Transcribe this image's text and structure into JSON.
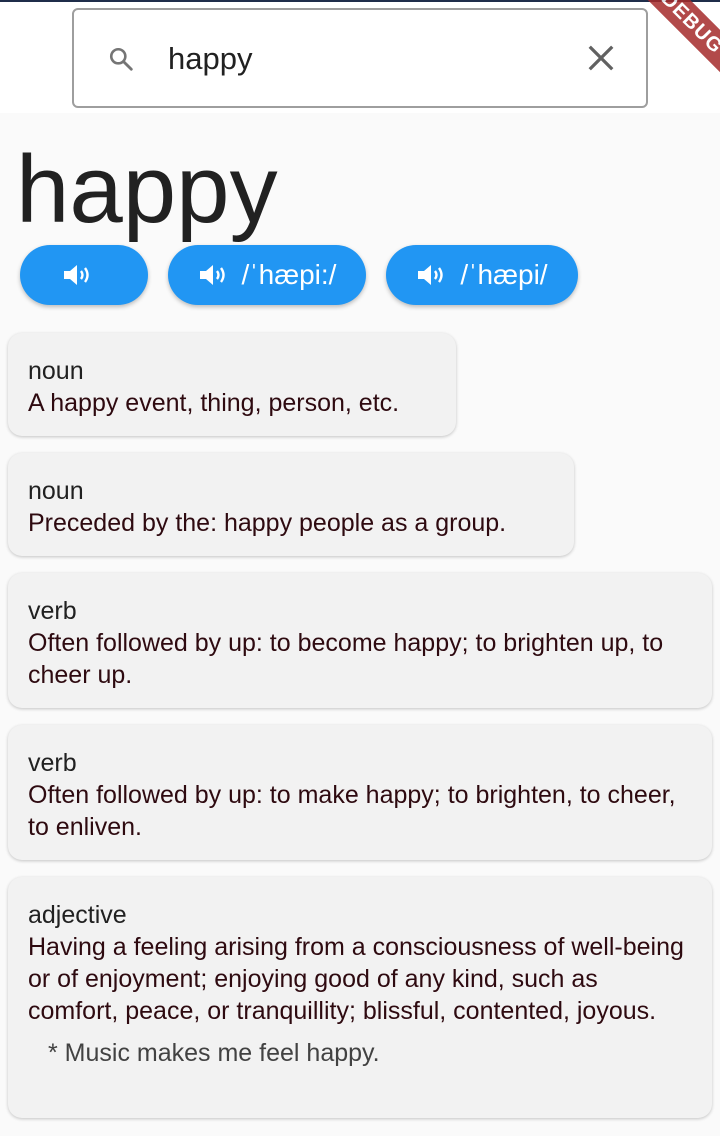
{
  "search": {
    "value": "happy",
    "placeholder": ""
  },
  "debug_banner": "DEBUG",
  "word": "happy",
  "pronunciations": [
    {
      "label": ""
    },
    {
      "label": "/ˈhæpi:/"
    },
    {
      "label": "/ˈhæpi/"
    }
  ],
  "definitions": [
    {
      "pos": "noun",
      "text": "A happy event, thing, person, etc."
    },
    {
      "pos": "noun",
      "text": "Preceded by the: happy people as a group."
    },
    {
      "pos": "verb",
      "text": "Often followed by up: to become happy; to brighten up, to cheer up."
    },
    {
      "pos": "verb",
      "text": "Often followed by up: to make happy; to brighten, to cheer, to enliven."
    },
    {
      "pos": "adjective",
      "text": "Having a feeling arising from a consciousness of well-being or of enjoyment; enjoying good of any kind, such as comfort, peace, or tranquillity; blissful, contented, joyous.",
      "example": "* Music makes me feel happy."
    }
  ],
  "colors": {
    "accent": "#2196f3",
    "card": "#f2f2f2",
    "debug": "#a52b2b"
  },
  "icons": {
    "search": "search-icon",
    "clear": "close-icon",
    "speaker": "volume-up-icon"
  }
}
